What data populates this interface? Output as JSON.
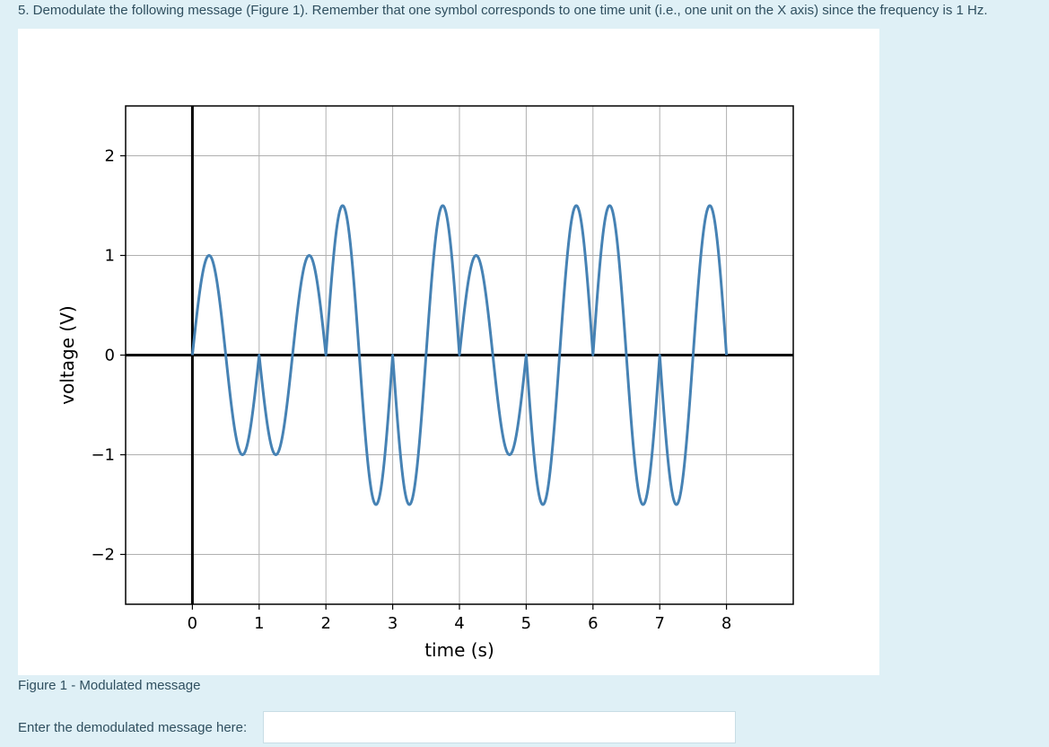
{
  "question": {
    "text": "5. Demodulate the following message (Figure 1). Remember that one symbol corresponds to one time unit (i.e., one unit on the X axis) since the frequency is 1 Hz."
  },
  "figure": {
    "caption": "Figure 1 - Modulated message"
  },
  "answer": {
    "label": "Enter the demodulated message here:",
    "value": "",
    "placeholder": ""
  },
  "chart_data": {
    "type": "line",
    "title": "",
    "xlabel": "time (s)",
    "ylabel": "voltage (V)",
    "xlim": [
      -1,
      9
    ],
    "ylim": [
      -2.5,
      2.5
    ],
    "xticks": [
      "0",
      "1",
      "2",
      "3",
      "4",
      "5",
      "6",
      "7",
      "8"
    ],
    "yticks": [
      "−2",
      "−1",
      "0",
      "1",
      "2"
    ],
    "grid": true,
    "line_color": "#4682b4",
    "symbols": [
      {
        "interval": [
          0,
          1
        ],
        "amplitude": 1,
        "phase_deg": 0
      },
      {
        "interval": [
          1,
          2
        ],
        "amplitude": 1,
        "phase_deg": 180
      },
      {
        "interval": [
          2,
          3
        ],
        "amplitude": 1.5,
        "phase_deg": 0
      },
      {
        "interval": [
          3,
          4
        ],
        "amplitude": 1.5,
        "phase_deg": 180
      },
      {
        "interval": [
          4,
          5
        ],
        "amplitude": 1,
        "phase_deg": 0
      },
      {
        "interval": [
          5,
          6
        ],
        "amplitude": 1.5,
        "phase_deg": 180
      },
      {
        "interval": [
          6,
          7
        ],
        "amplitude": 1.5,
        "phase_deg": 0
      },
      {
        "interval": [
          7,
          8
        ],
        "amplitude": 1.5,
        "phase_deg": 180
      }
    ]
  }
}
